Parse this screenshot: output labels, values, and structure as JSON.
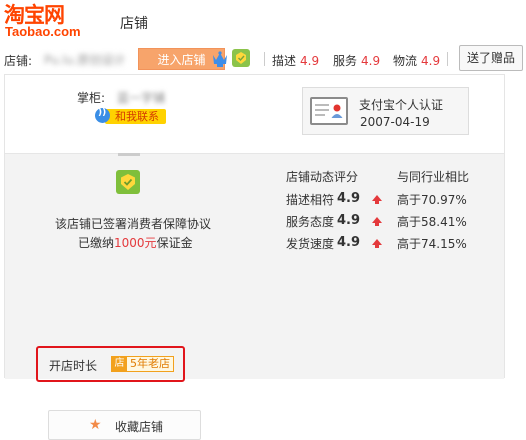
{
  "header": {
    "logo_cn": "淘宝网",
    "logo_en": "Taobao.com",
    "page_title": "店铺"
  },
  "shop_bar": {
    "shop_label": "店铺:",
    "shop_name": "Pu.lu.原创设计",
    "enter_shop": "进入店铺",
    "metrics": [
      {
        "label": "描述",
        "value": "4.9"
      },
      {
        "label": "服务",
        "value": "4.9"
      },
      {
        "label": "物流",
        "value": "4.9"
      }
    ],
    "gift_button": "送了赠品"
  },
  "keeper": {
    "label": "掌柜:",
    "name": "蓝一字铺",
    "contact": "和我联系"
  },
  "auth": {
    "title": "支付宝个人认证",
    "date": "2007-04-19"
  },
  "guarantee": {
    "line1": "该店铺已签署消费者保障协议",
    "line2_prefix": "已缴纳",
    "deposit": "1000元",
    "line2_suffix": "保证金"
  },
  "ratings": {
    "header": "店铺动态评分",
    "compare_header": "与同行业相比",
    "rows": [
      {
        "label": "描述相符",
        "value": "4.9",
        "compare": "高于70.97%"
      },
      {
        "label": "服务态度",
        "value": "4.9",
        "compare": "高于58.41%"
      },
      {
        "label": "发货速度",
        "value": "4.9",
        "compare": "高于74.15%"
      }
    ]
  },
  "shop_age": {
    "label": "开店时长",
    "badge_icon": "店",
    "badge_text": "5年老店"
  },
  "favorite": {
    "label": "收藏店铺",
    "icon": "star-icon"
  },
  "colors": {
    "brand": "#ff4400",
    "accent_red": "#e4393c",
    "enter_button": "#f7a46b",
    "highlight_box": "#e1151b"
  }
}
